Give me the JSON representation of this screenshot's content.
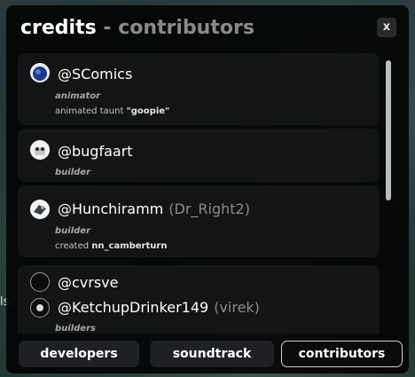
{
  "background": {
    "cutoff_text": "ls."
  },
  "window": {
    "title_main": "credits",
    "title_separator": "-",
    "title_sub": "contributors",
    "close_label": "x"
  },
  "contributors": [
    {
      "handle": "@SComics",
      "alias": "",
      "role": "animator",
      "desc_prefix": "animated taunt",
      "desc_item": "\"goopie\""
    },
    {
      "handle": "@bugfaart",
      "alias": "",
      "role": "builder",
      "desc_prefix": "",
      "desc_item": ""
    },
    {
      "handle": "@Hunchiramm",
      "alias": "(Dr_Right2)",
      "role": "builder",
      "desc_prefix": "created",
      "desc_item": "nn_camberturn"
    },
    {
      "handle": "@cvrsve",
      "alias": "",
      "role": "",
      "desc_prefix": "",
      "desc_item": ""
    },
    {
      "handle": "@KetchupDrinker149",
      "alias": "(virek)",
      "role": "builders",
      "desc_prefix": "",
      "desc_item": ""
    }
  ],
  "tabs": [
    {
      "label": "developers",
      "active": false
    },
    {
      "label": "soundtrack",
      "active": false
    },
    {
      "label": "contributors",
      "active": true
    }
  ]
}
